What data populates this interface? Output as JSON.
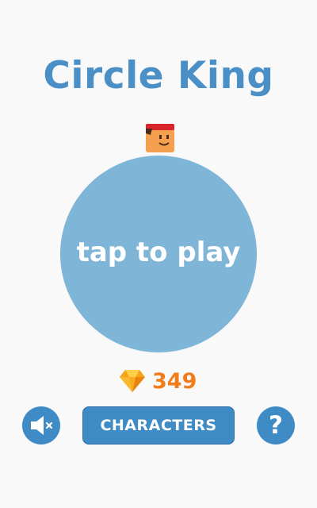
{
  "game": {
    "title": "Circle King",
    "play_label": "tap to play",
    "gem_count": "349",
    "characters_label": "CHARACTERS",
    "help_label": "?"
  },
  "icons": {
    "character": "player-character-icon",
    "gem": "diamond-gem-icon",
    "mute": "speaker-muted-icon",
    "help": "question-mark-icon"
  },
  "colors": {
    "background": "#f9f9f9",
    "title": "#4a8fc6",
    "circle": "#7fb5d6",
    "button": "#3f8bc6",
    "gem_text": "#f07d1a",
    "character_skin": "#f5a04f",
    "headband": "#d8232a"
  }
}
